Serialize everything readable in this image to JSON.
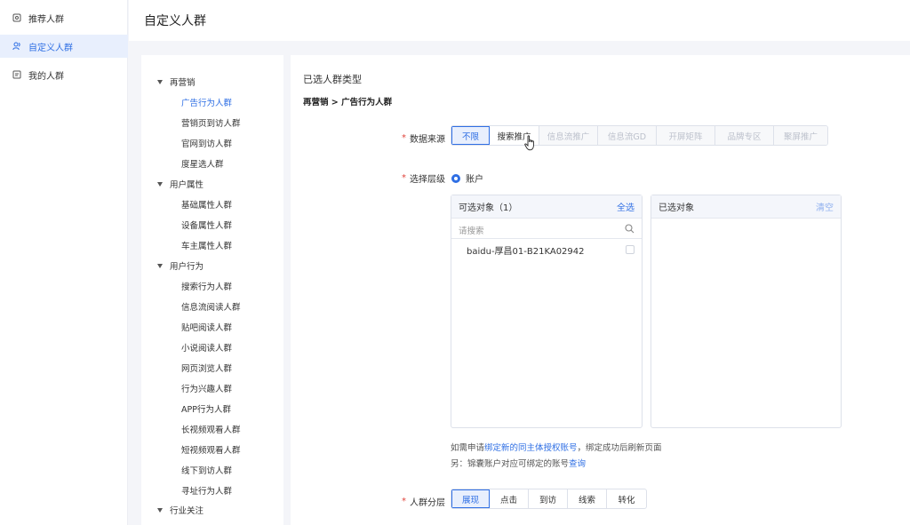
{
  "sidebar": {
    "items": [
      {
        "label": "推荐人群",
        "icon": "recommend-icon",
        "active": false
      },
      {
        "label": "自定义人群",
        "icon": "users-icon",
        "active": true
      },
      {
        "label": "我的人群",
        "icon": "folder-icon",
        "active": false
      }
    ]
  },
  "header": {
    "title": "自定义人群"
  },
  "tree": {
    "groups": [
      {
        "label": "再营销",
        "items": [
          "广告行为人群",
          "营销页到访人群",
          "官网到访人群",
          "度星选人群"
        ]
      },
      {
        "label": "用户属性",
        "items": [
          "基础属性人群",
          "设备属性人群",
          "车主属性人群"
        ]
      },
      {
        "label": "用户行为",
        "items": [
          "搜索行为人群",
          "信息流阅读人群",
          "贴吧阅读人群",
          "小说阅读人群",
          "网页浏览人群",
          "行为兴趣人群",
          "APP行为人群",
          "长视频观看人群",
          "短视频观看人群",
          "线下到访人群",
          "寻址行为人群"
        ]
      },
      {
        "label": "行业关注",
        "items": []
      }
    ],
    "active_item": "广告行为人群"
  },
  "main": {
    "section_title": "已选人群类型",
    "breadcrumb": "再营销 > 广告行为人群",
    "data_source": {
      "label": "数据来源",
      "options": [
        "不限",
        "搜索推广",
        "信息流推广",
        "信息流GD",
        "开屏矩阵",
        "品牌专区",
        "聚屏推广"
      ],
      "selected": "不限",
      "disabled": [
        "信息流推广",
        "信息流GD",
        "开屏矩阵",
        "品牌专区",
        "聚屏推广"
      ]
    },
    "level": {
      "label": "选择层级",
      "option": "账户"
    },
    "available": {
      "title": "可选对象（1）",
      "select_all": "全选",
      "search_placeholder": "请搜索",
      "items": [
        "baidu-厚昌01-B21KA02942"
      ]
    },
    "selected_panel": {
      "title": "已选对象",
      "clear": "清空"
    },
    "hint": {
      "line1_pre": "如需申请",
      "line1_link": "绑定新的同主体授权账号",
      "line1_post": "，绑定成功后刷新页面",
      "line2_pre": "另：锦囊账户对应可绑定的账号",
      "line2_link": "查询"
    },
    "layer": {
      "label": "人群分层",
      "options": [
        "展现",
        "点击",
        "到访",
        "线索",
        "转化"
      ],
      "selected": "展现"
    }
  },
  "colors": {
    "accent": "#2f6fe4",
    "required": "#e0443b",
    "disabled": "#bcc1cc"
  }
}
